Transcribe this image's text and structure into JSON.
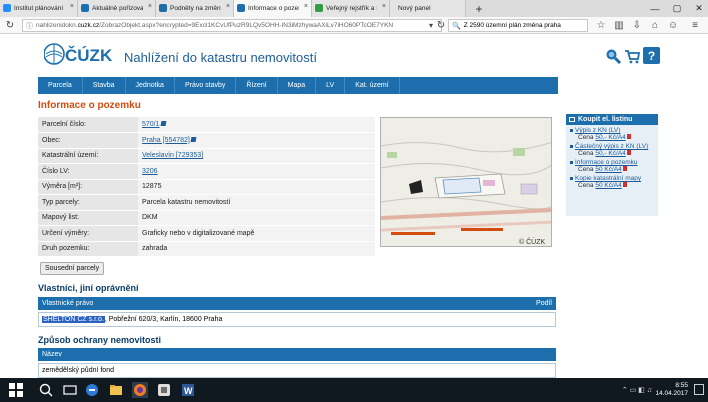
{
  "tabs": [
    {
      "label": "Institut plánování a r...",
      "icon_color": "#1e90ff",
      "active": false
    },
    {
      "label": "Aktuálně pořizované z...",
      "icon_color": "#1c6fac",
      "active": false
    },
    {
      "label": "Podněty na změny úze...",
      "icon_color": "#1c6fac",
      "active": false
    },
    {
      "label": "Informace o pozemku ...",
      "icon_color": "#1c6fac",
      "active": true
    },
    {
      "label": "Veřejný rejstřík a Sbírk...",
      "icon_color": "#2e9e3f",
      "active": false
    },
    {
      "label": "Nový panel",
      "icon_color": "",
      "active": false
    }
  ],
  "url": {
    "prefix": "nahlizenidokn.",
    "domain": "cuzk.cz",
    "rest": "/ZobrazObjekt.aspx?encrypted=9Excl1KCvUfPuzR9LQv5OHH-IN3iMzhywaAXiLv7iHO60PTcOE7YKN"
  },
  "search": {
    "text": "Z 2590 územní plán změna praha"
  },
  "site": {
    "logo": "ČÚZK",
    "title": "Nahlížení do katastru nemovitostí"
  },
  "menu": [
    "Parcela",
    "Stavba",
    "Jednotka",
    "Právo stavby",
    "Řízení",
    "Mapa",
    "LV",
    "Kat. území"
  ],
  "parcel": {
    "title": "Informace o pozemku",
    "rows": [
      {
        "key": "Parcelní číslo:",
        "value": "570/1",
        "link": true,
        "ext": true
      },
      {
        "key": "Obec:",
        "value": "Praha [554782]",
        "link": true,
        "ext": true
      },
      {
        "key": "Katastrální území:",
        "value": "Veleslavín [729353]",
        "link": true,
        "ext": false
      },
      {
        "key": "Číslo LV:",
        "value": "3206",
        "link": true,
        "ext": false
      },
      {
        "key": "Výměra [m²]:",
        "value": "12875",
        "link": false,
        "ext": false
      },
      {
        "key": "Typ parcely:",
        "value": "Parcela katastru nemovitostí",
        "link": false,
        "ext": false
      },
      {
        "key": "Mapový list:",
        "value": "DKM",
        "link": false,
        "ext": false
      },
      {
        "key": "Určení výměry:",
        "value": "Graficky nebo v digitalizované mapě",
        "link": false,
        "ext": false
      },
      {
        "key": "Druh pozemku:",
        "value": "zahrada",
        "link": false,
        "ext": false
      }
    ],
    "neighbors_button": "Sousední parcely",
    "map_watermark": "© ČÚZK"
  },
  "owners": {
    "heading": "Vlastníci, jiní oprávnění",
    "col_left": "Vlastnické právo",
    "col_right": "Podíl",
    "owner_name": "SHELTON CZ s.r.o.",
    "owner_addr": ", Pobřežní 620/3, Karlín, 18600 Praha"
  },
  "protection": {
    "heading": "Způsob ochrany nemovitosti",
    "col": "Název",
    "value": "zemědělský půdní fond"
  },
  "sidebar": {
    "heading": "Koupit el. listinu",
    "items": [
      {
        "title": "Výpis z KN (LV)",
        "price_label": "Cena",
        "price": "50,- Kč/A4"
      },
      {
        "title": "Částečný výpis z KN (LV)",
        "price_label": "Cena",
        "price": "50,- Kč/A4"
      },
      {
        "title": "Informace o pozemku",
        "price_label": "Cena",
        "price": "50 Kč/A4"
      },
      {
        "title": "Kopie katastrální mapy",
        "price_label": "Cena",
        "price": "50 Kč/A4"
      }
    ]
  },
  "taskbar": {
    "time": "8:55",
    "date": "14.04.2017"
  },
  "colors": {
    "brand_blue": "#1c6fac",
    "title_orange": "#d24c10",
    "link": "#1c5d99"
  }
}
